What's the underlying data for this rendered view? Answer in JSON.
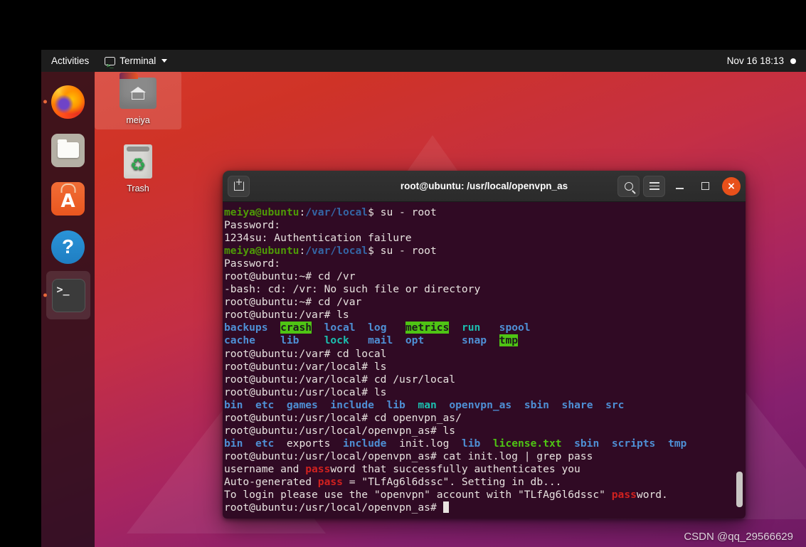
{
  "topbar": {
    "activities": "Activities",
    "app_name": "Terminal",
    "app_icon": "terminal-icon",
    "caret_icon": "chevron-down-icon",
    "clock": "Nov 16  18:13",
    "status_indicator": "status-dot"
  },
  "dock": {
    "items": [
      {
        "name": "firefox",
        "label": "Firefox",
        "running": true
      },
      {
        "name": "files",
        "label": "Files",
        "running": false
      },
      {
        "name": "software",
        "label": "Ubuntu Software",
        "glyph": "A",
        "running": false
      },
      {
        "name": "help",
        "label": "Help",
        "glyph": "?",
        "running": false
      },
      {
        "name": "terminal",
        "label": "Terminal",
        "glyph": ">_",
        "running": true
      }
    ]
  },
  "desktop": {
    "icons": [
      {
        "name": "home-folder",
        "label": "meiya",
        "selected": true
      },
      {
        "name": "trash",
        "label": "Trash",
        "selected": false
      }
    ]
  },
  "terminal": {
    "title": "root@ubuntu: /usr/local/openvpn_as",
    "buttons": {
      "new_tab": "new-tab-icon",
      "search": "search-icon",
      "menu": "hamburger-menu-icon",
      "minimize": "minimize-icon",
      "maximize": "maximize-icon",
      "close": "close-icon",
      "close_glyph": "×"
    },
    "colors": {
      "background": "#300a24",
      "foreground": "#e8e3e0",
      "user_green": "#4e9a06",
      "path_blue": "#3465a4",
      "dir_blue": "#4e8fd4",
      "link_cyan": "#1bbfaf",
      "exec_green": "#4fc414",
      "match_red": "#d0211f",
      "titlebar": "#2c2c2c",
      "close_button": "#e8501a"
    },
    "lines": [
      {
        "segments": [
          {
            "t": "meiya@ubuntu",
            "c": "c-user"
          },
          {
            "t": ":",
            "c": "c-white"
          },
          {
            "t": "/var/local",
            "c": "c-path"
          },
          {
            "t": "$ su - root",
            "c": "c-white"
          }
        ]
      },
      {
        "segments": [
          {
            "t": "Password:",
            "c": "c-white"
          }
        ]
      },
      {
        "segments": [
          {
            "t": "1234su: Authentication failure",
            "c": "c-white"
          }
        ]
      },
      {
        "segments": [
          {
            "t": "meiya@ubuntu",
            "c": "c-user"
          },
          {
            "t": ":",
            "c": "c-white"
          },
          {
            "t": "/var/local",
            "c": "c-path"
          },
          {
            "t": "$ su - root",
            "c": "c-white"
          }
        ]
      },
      {
        "segments": [
          {
            "t": "Password:",
            "c": "c-white"
          }
        ]
      },
      {
        "segments": [
          {
            "t": "root@ubuntu:~# cd /vr",
            "c": "c-white"
          }
        ]
      },
      {
        "segments": [
          {
            "t": "-bash: cd: /vr: No such file or directory",
            "c": "c-white"
          }
        ]
      },
      {
        "segments": [
          {
            "t": "root@ubuntu:~# cd /var",
            "c": "c-white"
          }
        ]
      },
      {
        "segments": [
          {
            "t": "root@ubuntu:/var# ls",
            "c": "c-white"
          }
        ]
      },
      {
        "segments": [
          {
            "t": "backups",
            "c": "c-dir"
          },
          {
            "t": "  ",
            "c": "c-white"
          },
          {
            "t": "crash",
            "c": "c-sticky"
          },
          {
            "t": "  ",
            "c": "c-white"
          },
          {
            "t": "local",
            "c": "c-dir"
          },
          {
            "t": "  ",
            "c": "c-white"
          },
          {
            "t": "log",
            "c": "c-dir"
          },
          {
            "t": "   ",
            "c": "c-white"
          },
          {
            "t": "metrics",
            "c": "c-sticky"
          },
          {
            "t": "  ",
            "c": "c-white"
          },
          {
            "t": "run",
            "c": "c-link"
          },
          {
            "t": "   ",
            "c": "c-white"
          },
          {
            "t": "spool",
            "c": "c-dir"
          }
        ]
      },
      {
        "segments": [
          {
            "t": "cache",
            "c": "c-dir"
          },
          {
            "t": "    ",
            "c": "c-white"
          },
          {
            "t": "lib",
            "c": "c-dir"
          },
          {
            "t": "    ",
            "c": "c-white"
          },
          {
            "t": "lock",
            "c": "c-link"
          },
          {
            "t": "   ",
            "c": "c-white"
          },
          {
            "t": "mail",
            "c": "c-dir"
          },
          {
            "t": "  ",
            "c": "c-white"
          },
          {
            "t": "opt",
            "c": "c-dir"
          },
          {
            "t": "      ",
            "c": "c-white"
          },
          {
            "t": "snap",
            "c": "c-dir"
          },
          {
            "t": "  ",
            "c": "c-white"
          },
          {
            "t": "tmp",
            "c": "c-sticky"
          }
        ]
      },
      {
        "segments": [
          {
            "t": "root@ubuntu:/var# cd local",
            "c": "c-white"
          }
        ]
      },
      {
        "segments": [
          {
            "t": "root@ubuntu:/var/local# ls",
            "c": "c-white"
          }
        ]
      },
      {
        "segments": [
          {
            "t": "root@ubuntu:/var/local# cd /usr/local",
            "c": "c-white"
          }
        ]
      },
      {
        "segments": [
          {
            "t": "root@ubuntu:/usr/local# ls",
            "c": "c-white"
          }
        ]
      },
      {
        "segments": [
          {
            "t": "bin",
            "c": "c-dir"
          },
          {
            "t": "  ",
            "c": "c-white"
          },
          {
            "t": "etc",
            "c": "c-dir"
          },
          {
            "t": "  ",
            "c": "c-white"
          },
          {
            "t": "games",
            "c": "c-dir"
          },
          {
            "t": "  ",
            "c": "c-white"
          },
          {
            "t": "include",
            "c": "c-dir"
          },
          {
            "t": "  ",
            "c": "c-white"
          },
          {
            "t": "lib",
            "c": "c-dir"
          },
          {
            "t": "  ",
            "c": "c-white"
          },
          {
            "t": "man",
            "c": "c-link"
          },
          {
            "t": "  ",
            "c": "c-white"
          },
          {
            "t": "openvpn_as",
            "c": "c-dir"
          },
          {
            "t": "  ",
            "c": "c-white"
          },
          {
            "t": "sbin",
            "c": "c-dir"
          },
          {
            "t": "  ",
            "c": "c-white"
          },
          {
            "t": "share",
            "c": "c-dir"
          },
          {
            "t": "  ",
            "c": "c-white"
          },
          {
            "t": "src",
            "c": "c-dir"
          }
        ]
      },
      {
        "segments": [
          {
            "t": "root@ubuntu:/usr/local# cd openvpn_as/",
            "c": "c-white"
          }
        ]
      },
      {
        "segments": [
          {
            "t": "root@ubuntu:/usr/local/openvpn_as# ls",
            "c": "c-white"
          }
        ]
      },
      {
        "segments": [
          {
            "t": "bin",
            "c": "c-dir"
          },
          {
            "t": "  ",
            "c": "c-white"
          },
          {
            "t": "etc",
            "c": "c-dir"
          },
          {
            "t": "  ",
            "c": "c-white"
          },
          {
            "t": "exports",
            "c": "c-white"
          },
          {
            "t": "  ",
            "c": "c-white"
          },
          {
            "t": "include",
            "c": "c-dir"
          },
          {
            "t": "  ",
            "c": "c-white"
          },
          {
            "t": "init.log",
            "c": "c-white"
          },
          {
            "t": "  ",
            "c": "c-white"
          },
          {
            "t": "lib",
            "c": "c-dir"
          },
          {
            "t": "  ",
            "c": "c-white"
          },
          {
            "t": "license.txt",
            "c": "c-exec"
          },
          {
            "t": "  ",
            "c": "c-white"
          },
          {
            "t": "sbin",
            "c": "c-dir"
          },
          {
            "t": "  ",
            "c": "c-white"
          },
          {
            "t": "scripts",
            "c": "c-dir"
          },
          {
            "t": "  ",
            "c": "c-white"
          },
          {
            "t": "tmp",
            "c": "c-dir"
          }
        ]
      },
      {
        "segments": [
          {
            "t": "root@ubuntu:/usr/local/openvpn_as# cat init.log | grep pass",
            "c": "c-white"
          }
        ]
      },
      {
        "segments": [
          {
            "t": "username and ",
            "c": "c-white"
          },
          {
            "t": "pass",
            "c": "c-match"
          },
          {
            "t": "word that successfully authenticates you",
            "c": "c-white"
          }
        ]
      },
      {
        "segments": [
          {
            "t": "Auto-generated ",
            "c": "c-white"
          },
          {
            "t": "pass",
            "c": "c-match"
          },
          {
            "t": " = \"TLfAg6l6dssc\". Setting in db...",
            "c": "c-white"
          }
        ]
      },
      {
        "segments": [
          {
            "t": "To login please use the \"openvpn\" account with \"TLfAg6l6dssc\" ",
            "c": "c-white"
          },
          {
            "t": "pass",
            "c": "c-match"
          },
          {
            "t": "word.",
            "c": "c-white"
          }
        ]
      },
      {
        "segments": [
          {
            "t": "root@ubuntu:/usr/local/openvpn_as# ",
            "c": "c-white"
          }
        ],
        "cursor": true
      }
    ]
  },
  "watermark": {
    "text": "CSDN @qq_29566629"
  }
}
